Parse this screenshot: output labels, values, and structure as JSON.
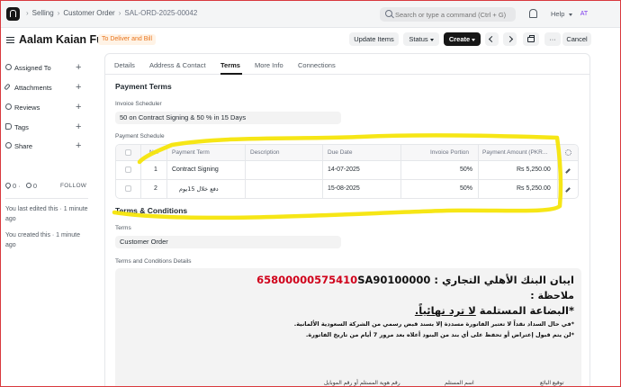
{
  "navbar": {
    "breadcrumbs": [
      "Selling",
      "Customer Order",
      "SAL-ORD-2025-00042"
    ],
    "search_placeholder": "Search or type a command (Ctrl + G)",
    "help_label": "Help",
    "avatar_initials": "AT"
  },
  "header": {
    "title": "Aalam Kaian Fur.",
    "status": "To Deliver and Bill",
    "buttons": {
      "update_items": "Update Items",
      "status": "Status",
      "create": "Create",
      "cancel": "Cancel"
    }
  },
  "sidebar": {
    "items": [
      {
        "label": "Assigned To",
        "icon": "user-icon"
      },
      {
        "label": "Attachments",
        "icon": "paperclip-icon"
      },
      {
        "label": "Reviews",
        "icon": "review-icon"
      },
      {
        "label": "Tags",
        "icon": "tag-icon"
      },
      {
        "label": "Share",
        "icon": "share-icon"
      }
    ],
    "likes": "0",
    "comments": "0",
    "follow_label": "FOLLOW",
    "activity": [
      "You last edited this · 1 minute ago",
      "You created this · 1 minute ago"
    ]
  },
  "tabs": [
    "Details",
    "Address & Contact",
    "Terms",
    "More Info",
    "Connections"
  ],
  "active_tab": "Terms",
  "payment_terms": {
    "section_title": "Payment Terms",
    "scheduler_label": "Invoice Scheduler",
    "scheduler_value": "50 on Contract Signing & 50 % in 15 Days",
    "schedule_label": "Payment Schedule",
    "columns": [
      "No.",
      "Payment Term",
      "Description",
      "Due Date",
      "Invoice Portion",
      "Payment Amount (PKR..."
    ],
    "rows": [
      {
        "no": "1",
        "term": "Contract Signing",
        "description": "",
        "due_date": "14-07-2025",
        "portion": "50%",
        "amount": "Rs 5,250.00"
      },
      {
        "no": "2",
        "term": "دفع خلال 15يوم",
        "description": "",
        "due_date": "15-08-2025",
        "portion": "50%",
        "amount": "Rs 5,250.00"
      }
    ]
  },
  "terms_conditions": {
    "section_title": "Terms & Conditions",
    "terms_label": "Terms",
    "terms_value": "Customer Order",
    "details_label": "Terms and Conditions Details",
    "iban_text": "ايبان البنك الأهلي التجاري :",
    "iban_number": "SA90100000",
    "iban_red": "65800000575410",
    "note": "ملاحظة :",
    "goods_prefix": "*البضاعة المستلمة",
    "goods_underlined": "لا ترد نهائياً.",
    "line1": "*في حال السداد نقداً لا تعتبر الفاتورة مسددة إلا بسند قبض رسمي من الشركة السعودية الألمانية.",
    "line2": "*لن يتم قبول إعتراض أو تحفظ على أي بند من البنود أعلاه بعد مرور 7 أيام من تاريخ الفاتورة.",
    "signatures": [
      "توقيع البائع",
      "اسم المستلم",
      "رقم هوية المستلم أو رقم الموبايل"
    ]
  },
  "annotation_color": "#f5e50a"
}
